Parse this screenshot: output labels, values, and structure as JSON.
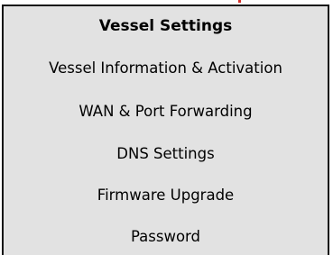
{
  "menu": {
    "header": "Vessel Settings",
    "items": [
      {
        "label": "Vessel Information & Activation"
      },
      {
        "label": "WAN & Port Forwarding"
      },
      {
        "label": "DNS Settings"
      },
      {
        "label": "Firmware Upgrade"
      },
      {
        "label": "Password"
      }
    ]
  },
  "colors": {
    "panel_background": "#e2e2e2",
    "border": "#111111",
    "accent_mark": "#d4302a"
  }
}
